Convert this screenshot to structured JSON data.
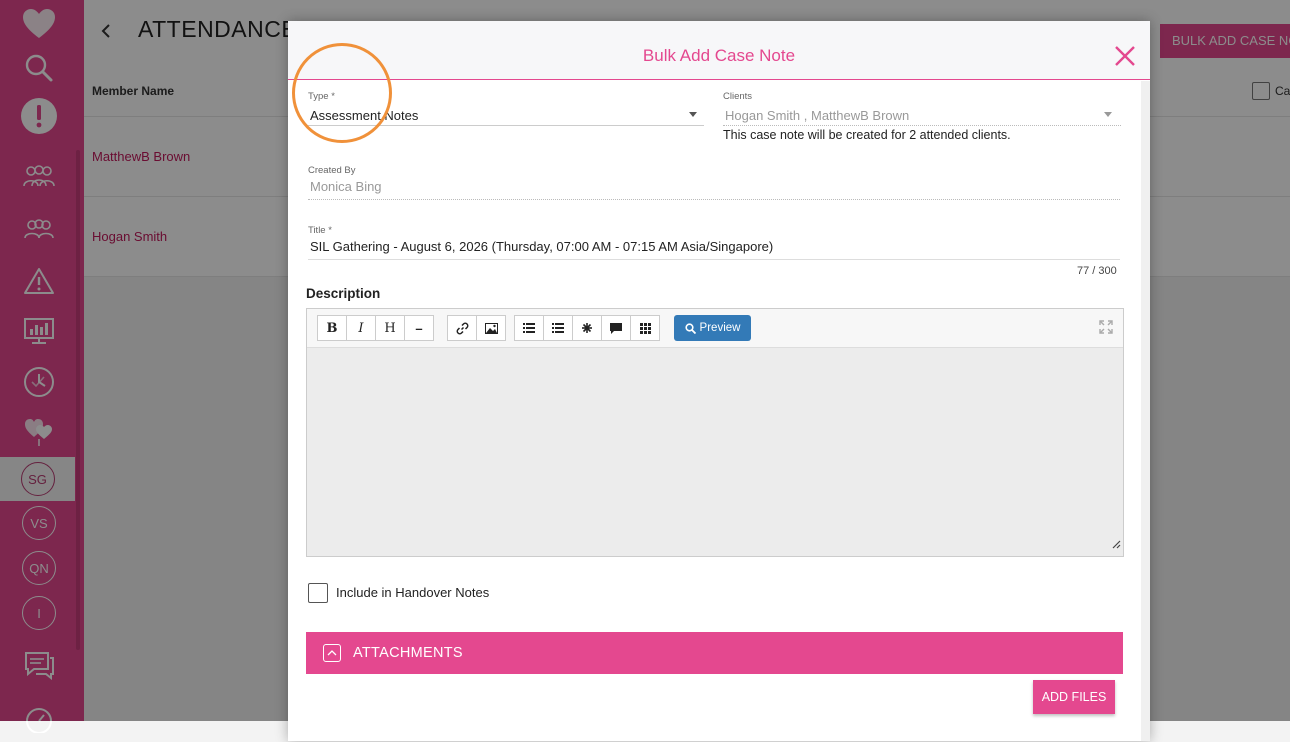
{
  "page": {
    "title": "ATTENDANCE",
    "bulk_button": "BULK ADD CASE NOTE",
    "table": {
      "member_header": "Member Name",
      "check_header": "Ca",
      "rows": [
        {
          "name": "MatthewB Brown"
        },
        {
          "name": "Hogan Smith"
        }
      ]
    }
  },
  "sidebar": {
    "items": [
      {
        "icon": "heart-logo-icon"
      },
      {
        "icon": "search-icon"
      },
      {
        "icon": "alert-circle-icon"
      },
      {
        "icon": "clients-icon"
      },
      {
        "icon": "groups-icon"
      },
      {
        "icon": "warning-icon"
      },
      {
        "icon": "dashboard-icon"
      },
      {
        "icon": "schedule-icon"
      },
      {
        "icon": "care-heart-icon"
      }
    ],
    "badges": [
      "SG",
      "VS",
      "QN",
      "I"
    ],
    "active_badge": "SG",
    "bottom_items": [
      {
        "icon": "messages-icon"
      },
      {
        "icon": "timer-icon"
      }
    ]
  },
  "modal": {
    "title": "Bulk Add Case Note",
    "type": {
      "label": "Type *",
      "value": "Assessment Notes"
    },
    "clients": {
      "label": "Clients",
      "value": "Hogan Smith , MatthewB Brown",
      "hint": "This case note will be created for 2 attended clients."
    },
    "created_by": {
      "label": "Created By",
      "value": "Monica Bing"
    },
    "title_field": {
      "label": "Title *",
      "value": "SIL Gathering - August 6, 2026 (Thursday, 07:00 AM - 07:15 AM Asia/Singapore)",
      "counter": "77 / 300"
    },
    "description": {
      "label": "Description",
      "toolbar": {
        "bold": "B",
        "italic": "I",
        "heading": "H",
        "rule": "–",
        "preview": "Preview"
      }
    },
    "handover": {
      "label": "Include in Handover Notes",
      "checked": false
    },
    "attachments": {
      "label": "ATTACHMENTS",
      "add_files": "ADD FILES"
    }
  },
  "colors": {
    "brand": "#e4488f",
    "preview_button": "#337ab7",
    "highlight": "#f0913a"
  }
}
